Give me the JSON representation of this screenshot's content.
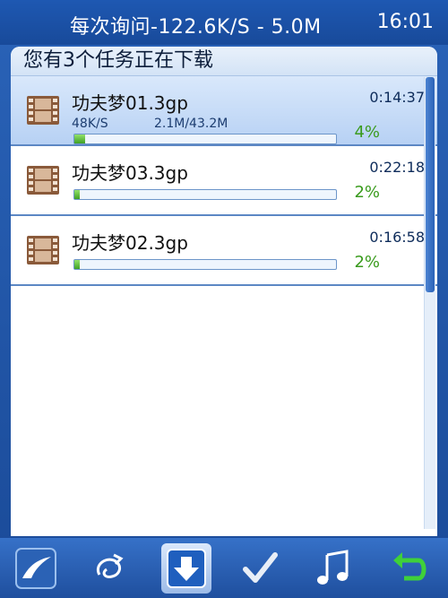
{
  "status_bar": {
    "text": "每次询问-122.6K/S - 5.0M",
    "time": "16:01"
  },
  "header": {
    "title": "您有3个任务正在下载"
  },
  "downloads": [
    {
      "name": "功夫梦01.3gp",
      "time": "0:14:37",
      "speed": "48K/S",
      "size": "2.1M/43.2M",
      "percent_label": "4%",
      "progress": 0.04,
      "selected": true
    },
    {
      "name": "功夫梦03.3gp",
      "time": "0:22:18",
      "percent_label": "2%",
      "progress": 0.02,
      "selected": false
    },
    {
      "name": "功夫梦02.3gp",
      "time": "0:16:58",
      "percent_label": "2%",
      "progress": 0.02,
      "selected": false
    }
  ],
  "toolbar": {
    "icons": [
      "home-swoosh-icon",
      "loop-icon",
      "download-icon",
      "checkmark-icon",
      "music-note-icon",
      "back-arrow-icon"
    ]
  },
  "colors": {
    "accent": "#1e58b2",
    "progress": "#3fa025",
    "selected_row": "#b7d1f4"
  }
}
